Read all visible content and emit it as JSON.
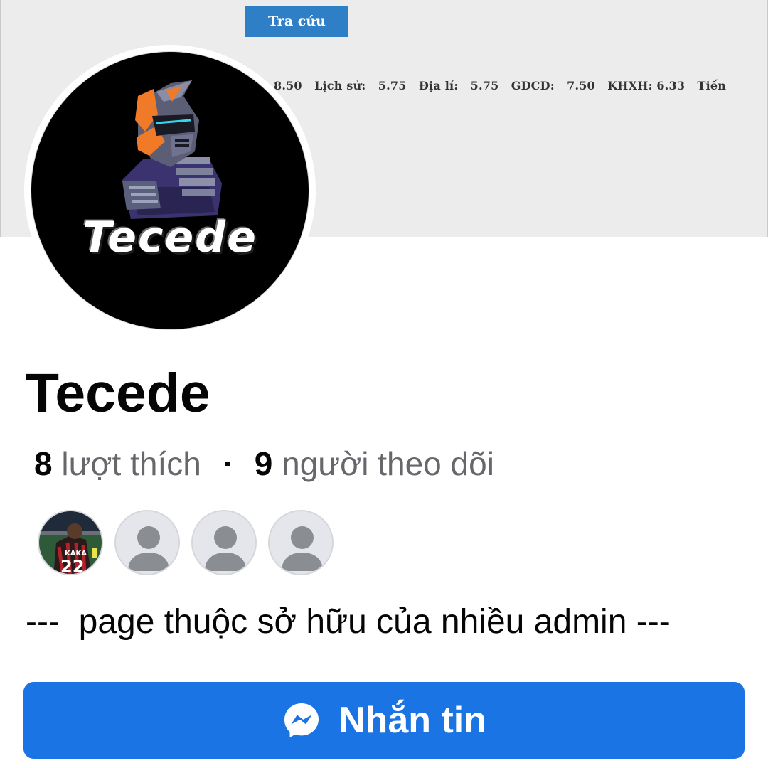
{
  "cover": {
    "lookup_button_label": "Tra cứu",
    "scores_text": "8.50   Lịch sử:   5.75   Địa lí:   5.75   GDCD:   7.50   KHXH: 6.33   Tiến"
  },
  "avatar": {
    "logo_text": "Tecede",
    "icon": "samurai-mascot-logo"
  },
  "profile": {
    "name": "Tecede",
    "likes_count": "8",
    "likes_label": "lượt thích",
    "separator": "·",
    "followers_count": "9",
    "followers_label": "người theo dõi"
  },
  "friends": {
    "avatars": [
      {
        "type": "photo",
        "icon": "football-player-photo"
      },
      {
        "type": "default",
        "icon": "default-person-icon"
      },
      {
        "type": "default",
        "icon": "default-person-icon"
      },
      {
        "type": "default",
        "icon": "default-person-icon"
      }
    ]
  },
  "description": "---  page thuộc sở hữu của nhiều admin ---",
  "message_button": {
    "label": "Nhắn tin",
    "icon": "messenger-icon"
  },
  "colors": {
    "accent": "#1b74e4",
    "text_primary": "#050505",
    "text_secondary": "#65676b",
    "cover_button": "#2f7fc6",
    "logo_orange": "#f07a28",
    "logo_purple": "#4a3a78"
  }
}
